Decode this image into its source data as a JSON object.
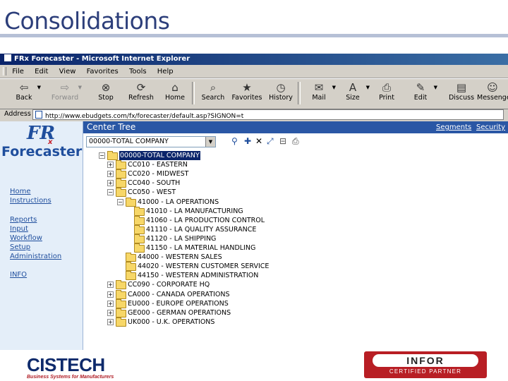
{
  "slide": {
    "title": "Consolidations"
  },
  "browser": {
    "title": "FRx Forecaster - Microsoft Internet Explorer",
    "menu": [
      "File",
      "Edit",
      "View",
      "Favorites",
      "Tools",
      "Help"
    ],
    "toolbar": [
      {
        "label": "Back",
        "icon": "back-arrow-icon"
      },
      {
        "label": "Forward",
        "icon": "forward-arrow-icon"
      },
      {
        "label": "Stop",
        "icon": "stop-icon"
      },
      {
        "label": "Refresh",
        "icon": "refresh-icon"
      },
      {
        "label": "Home",
        "icon": "home-icon"
      },
      {
        "label": "Search",
        "icon": "search-icon"
      },
      {
        "label": "Favorites",
        "icon": "favorites-icon"
      },
      {
        "label": "History",
        "icon": "history-icon"
      },
      {
        "label": "Mail",
        "icon": "mail-icon"
      },
      {
        "label": "Size",
        "icon": "size-icon"
      },
      {
        "label": "Print",
        "icon": "print-icon"
      },
      {
        "label": "Edit",
        "icon": "edit-icon"
      },
      {
        "label": "Discuss",
        "icon": "discuss-icon"
      },
      {
        "label": "Messenger",
        "icon": "messenger-icon"
      }
    ],
    "address_label": "Address",
    "address": "http://www.ebudgets.com/fx/forecaster/default.asp?SIGNON=t"
  },
  "app": {
    "logo_text": "Forecaster",
    "logo_mark": "FR",
    "logo_sub": "x",
    "nav": [
      {
        "label": "Home"
      },
      {
        "label": "Instructions"
      },
      {
        "label": "Reports"
      },
      {
        "label": "Input"
      },
      {
        "label": "Workflow"
      },
      {
        "label": "Setup"
      },
      {
        "label": "Administration"
      },
      {
        "label": "INFO"
      }
    ],
    "panel_title": "Center Tree",
    "links": {
      "segments": "Segments",
      "security": "Security"
    },
    "company_select": "00000-TOTAL COMPANY",
    "tree": [
      {
        "label": "00000-TOTAL COMPANY",
        "expander": "−",
        "selected": true
      },
      {
        "label": "CC010 - EASTERN",
        "expander": "+"
      },
      {
        "label": "CC020 - MIDWEST",
        "expander": "+"
      },
      {
        "label": "CC040 - SOUTH",
        "expander": "+"
      },
      {
        "label": "CC050 - WEST",
        "expander": "−"
      },
      {
        "label": "41000 - LA OPERATIONS",
        "expander": "−"
      },
      {
        "label": "41010 - LA MANUFACTURING",
        "expander": ""
      },
      {
        "label": "41060 - LA PRODUCTION CONTROL",
        "expander": ""
      },
      {
        "label": "41110 - LA QUALITY ASSURANCE",
        "expander": ""
      },
      {
        "label": "41120 - LA SHIPPING",
        "expander": ""
      },
      {
        "label": "41150 - LA MATERIAL HANDLING",
        "expander": ""
      },
      {
        "label": "44000 - WESTERN SALES",
        "expander": ""
      },
      {
        "label": "44020 - WESTERN CUSTOMER SERVICE",
        "expander": ""
      },
      {
        "label": "44150 - WESTERN ADMINISTRATION",
        "expander": ""
      },
      {
        "label": "CC090 - CORPORATE HQ",
        "expander": "+"
      },
      {
        "label": "CA000 - CANADA OPERATIONS",
        "expander": "+"
      },
      {
        "label": "EU000 - EUROPE OPERATIONS",
        "expander": "+"
      },
      {
        "label": "GE000 - GERMAN OPERATIONS",
        "expander": "+"
      },
      {
        "label": "UK000 - U.K. OPERATIONS",
        "expander": "+"
      }
    ]
  },
  "footer": {
    "cistech": "CISTECH",
    "cistech_tag": "Business Systems for Manufacturers",
    "infor": "INFOR",
    "infor_tag": "CERTIFIED PARTNER"
  }
}
